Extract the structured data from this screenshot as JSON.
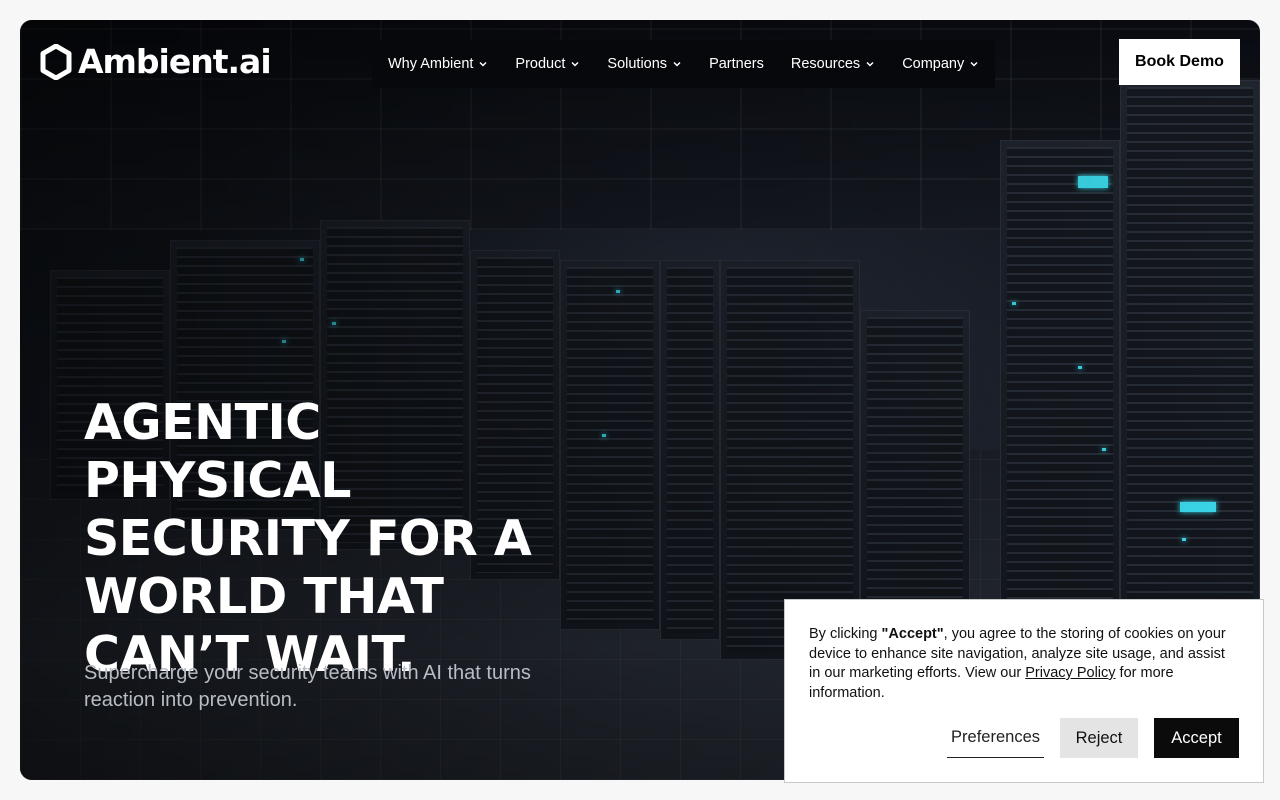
{
  "brand": {
    "logo_icon": "hexagon-logo-icon",
    "name": "Ambient.ai"
  },
  "nav": {
    "items": [
      {
        "label": "Why Ambient",
        "has_dropdown": true
      },
      {
        "label": "Product",
        "has_dropdown": true
      },
      {
        "label": "Solutions",
        "has_dropdown": true
      },
      {
        "label": "Partners",
        "has_dropdown": false
      },
      {
        "label": "Resources",
        "has_dropdown": true
      },
      {
        "label": "Company",
        "has_dropdown": true
      }
    ],
    "cta_label": "Book Demo"
  },
  "hero": {
    "headline": "AGENTIC PHYSICAL SECURITY FOR A WORLD THAT CAN’T WAIT.",
    "subheadline": "Supercharge your security teams with AI that turns reaction into prevention.",
    "background": "server-room-image"
  },
  "cookie_banner": {
    "text_before": "By clicking ",
    "accept_quote": "\"Accept\"",
    "text_middle": ", you agree to the storing of cookies on your device to enhance site navigation, analyze site usage, and assist in our marketing efforts. View our ",
    "privacy_link": "Privacy Policy",
    "text_after": " for more information.",
    "preferences_label": "Preferences",
    "reject_label": "Reject",
    "accept_label": "Accept"
  },
  "colors": {
    "page_bg": "#f7f7f7",
    "hero_bg": "#12161d",
    "accent_led": "#3ad6e8",
    "cta_bg": "#ffffff",
    "accept_bg": "#0b0b0b",
    "reject_bg": "#e4e4e4"
  }
}
